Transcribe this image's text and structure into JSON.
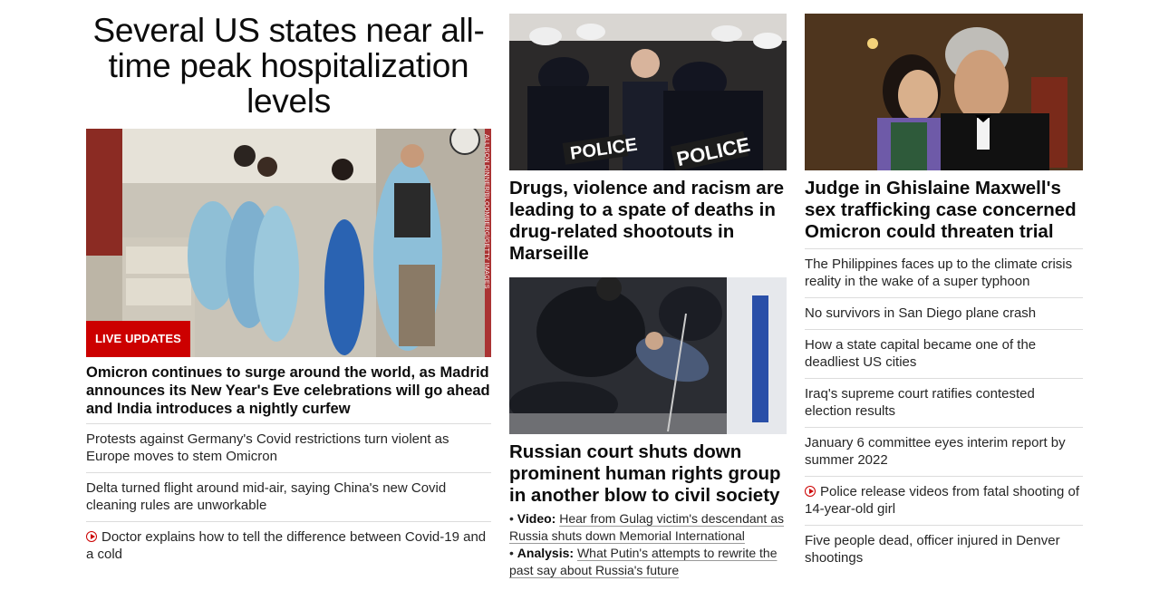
{
  "col1": {
    "headline": "Several US states near all-time peak hospitalization levels",
    "image_credit": "ALLISON DINNER/BLOOMBERG/GETTY IMAGES",
    "badge": "LIVE UPDATES",
    "lead": "Omicron continues to surge around the world, as Madrid announces its New Year's Eve celebrations will go ahead and India introduces a nightly curfew",
    "items": [
      {
        "text": "Protests against Germany's Covid restrictions turn violent as Europe moves to stem Omicron",
        "video": false
      },
      {
        "text": "Delta turned flight around mid-air, saying China's new Covid cleaning rules are unworkable",
        "video": false
      },
      {
        "text": "Doctor explains how to tell the difference between Covid-19 and a cold",
        "video": true
      }
    ]
  },
  "col2": {
    "story1": {
      "title": "Drugs, violence and racism are leading to a spate of deaths in drug-related shootouts in Marseille"
    },
    "story2": {
      "title": "Russian court shuts down prominent human rights group in another blow to civil society",
      "related": [
        {
          "prefix": "Video:",
          "text": "Hear from Gulag victim's descendant as Russia shuts down Memorial International"
        },
        {
          "prefix": "Analysis:",
          "text": "What Putin's attempts to rewrite the past say about Russia's future"
        }
      ]
    }
  },
  "col3": {
    "story1": {
      "title": "Judge in Ghislaine Maxwell's sex trafficking case concerned Omicron could threaten trial"
    },
    "items": [
      {
        "text": "The Philippines faces up to the climate crisis reality in the wake of a super typhoon",
        "video": false
      },
      {
        "text": "No survivors in San Diego plane crash",
        "video": false
      },
      {
        "text": "How a state capital became one of the deadliest US cities",
        "video": false
      },
      {
        "text": "Iraq's supreme court ratifies contested election results",
        "video": false
      },
      {
        "text": "January 6 committee eyes interim report by summer 2022",
        "video": false
      },
      {
        "text": "Police release videos from fatal shooting of 14-year-old girl",
        "video": true
      },
      {
        "text": "Five people dead, officer injured in Denver shootings",
        "video": false
      }
    ]
  },
  "colors": {
    "accent": "#cc0000",
    "text": "#0c0c0c",
    "divider": "#dcdcdc"
  }
}
